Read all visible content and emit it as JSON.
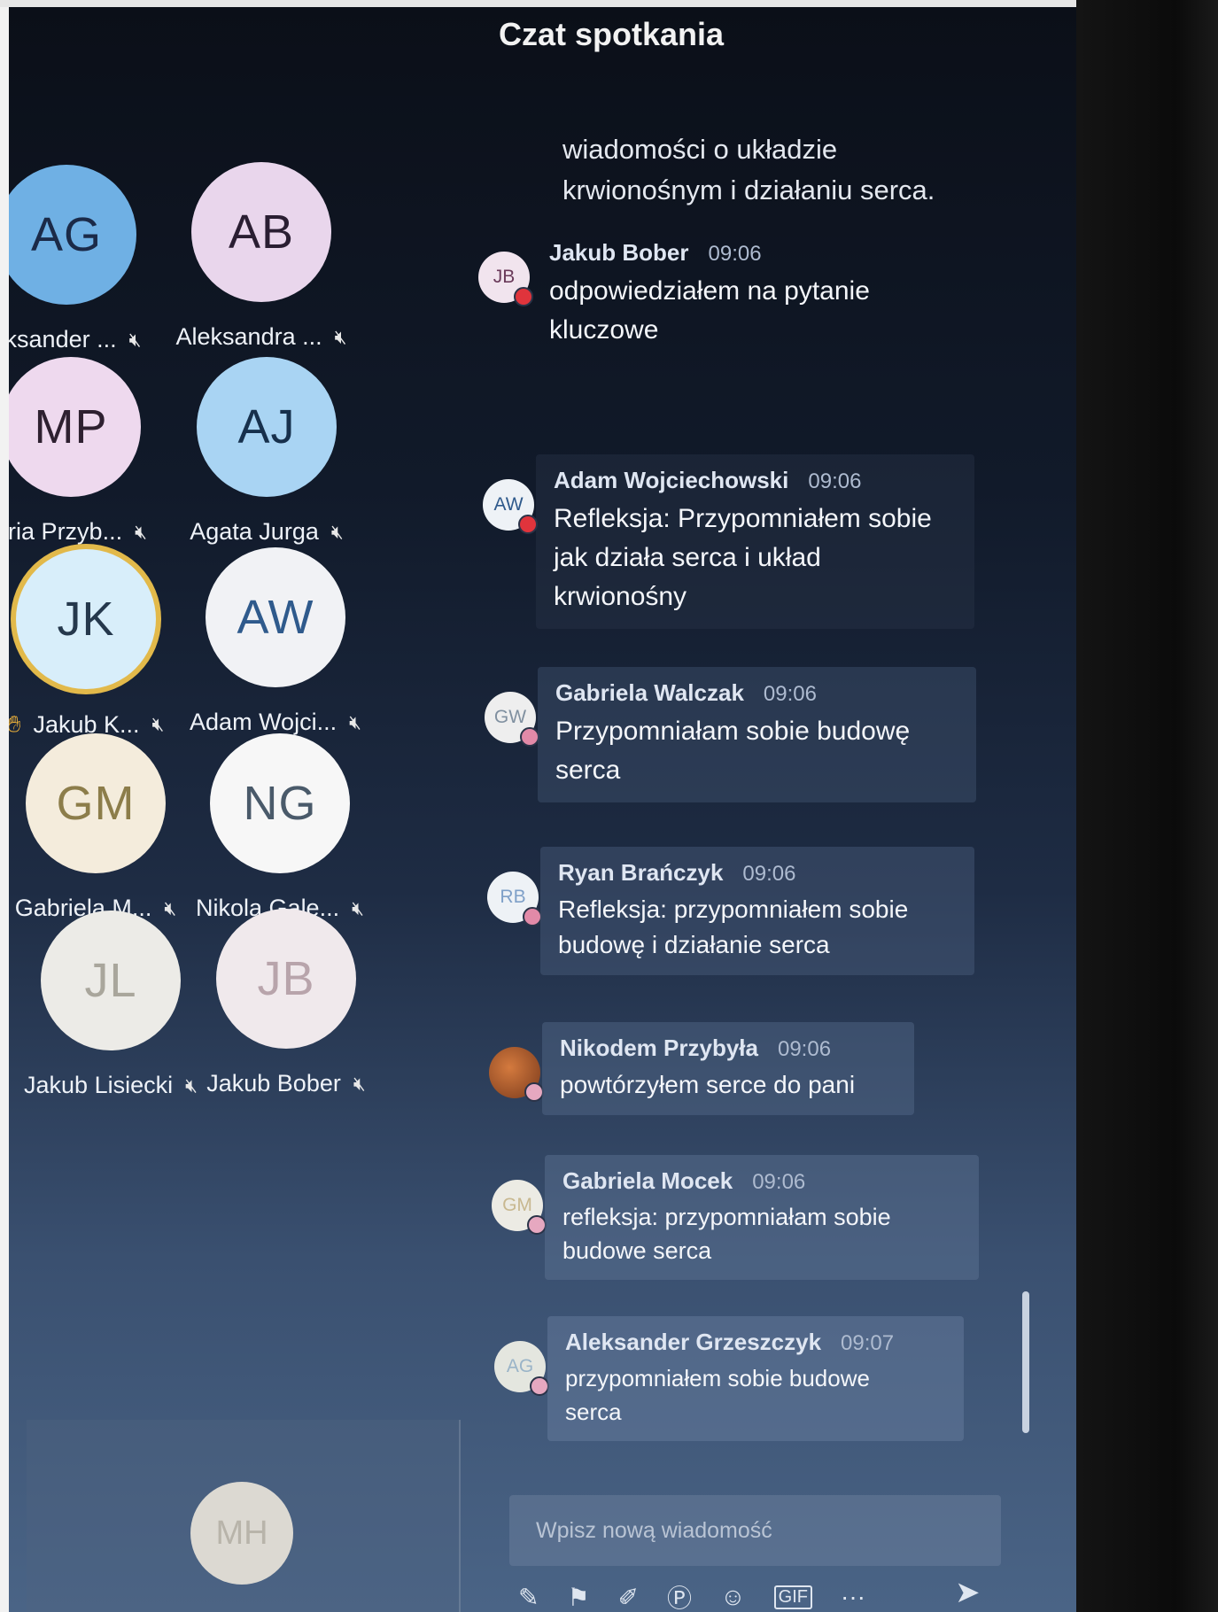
{
  "chat_title": "Czat spotkania",
  "intro_message": "wiadomości o układzie krwionośnym i działaniu serca.",
  "participants": [
    {
      "initials": "AG",
      "name": "eksander ...",
      "avatar_bg": "#6fb0e4",
      "avatar_fg": "#1b2a48",
      "raised_hand": false
    },
    {
      "initials": "AB",
      "name": "Aleksandra ...",
      "avatar_bg": "#e9d6ec",
      "avatar_fg": "#2a1e32",
      "raised_hand": false
    },
    {
      "initials": "MP",
      "name": "aria Przyb...",
      "avatar_bg": "#eed9ee",
      "avatar_fg": "#2e2030",
      "raised_hand": false
    },
    {
      "initials": "AJ",
      "name": "Agata Jurga",
      "avatar_bg": "#a9d4f3",
      "avatar_fg": "#17304c",
      "raised_hand": false
    },
    {
      "initials": "JK",
      "name": "Jakub K...",
      "avatar_bg": "#d8eefa",
      "avatar_fg": "#25384c",
      "raised_hand": true
    },
    {
      "initials": "AW",
      "name": "Adam Wojci...",
      "avatar_bg": "#f1f2f5",
      "avatar_fg": "#2f5a8c",
      "raised_hand": false
    },
    {
      "initials": "GM",
      "name": "Gabriela M...",
      "avatar_bg": "#f4ecdc",
      "avatar_fg": "#8c7d4a",
      "raised_hand": false
    },
    {
      "initials": "NG",
      "name": "Nikola Gale...",
      "avatar_bg": "#f7f7f7",
      "avatar_fg": "#4a5a6a",
      "raised_hand": false
    },
    {
      "initials": "JL",
      "name": "Jakub Lisiecki",
      "avatar_bg": "#ecebe7",
      "avatar_fg": "#a9a69c",
      "raised_hand": false
    },
    {
      "initials": "JB",
      "name": "Jakub Bober",
      "avatar_bg": "#f0e9ec",
      "avatar_fg": "#b8a4ab",
      "raised_hand": false
    }
  ],
  "bottom_participant": {
    "initials": "MH"
  },
  "messages": [
    {
      "initials": "JB",
      "author": "Jakub Bober",
      "time": "09:06",
      "text": "odpowiedziałem na pytanie kluczowe",
      "avatar_bg": "#f1e4ee",
      "avatar_fg": "#6a3a5a",
      "dot": "#e0343c"
    },
    {
      "initials": "AW",
      "author": "Adam Wojciechowski",
      "time": "09:06",
      "text": "Refleksja: Przypomniałem sobie jak działa serca i układ krwionośny",
      "avatar_bg": "#eef2f6",
      "avatar_fg": "#2f5a8c",
      "dot": "#e0343c"
    },
    {
      "initials": "GW",
      "author": "Gabriela Walczak",
      "time": "09:06",
      "text": "Przypomniałam sobie budowę serca",
      "avatar_bg": "#eeeeee",
      "avatar_fg": "#8090a0",
      "dot": "#e28aa8"
    },
    {
      "initials": "RB",
      "author": "Ryan Brańczyk",
      "time": "09:06",
      "text": "Refleksja: przypomniałem sobie budowę i działanie serca",
      "avatar_bg": "#eef2f6",
      "avatar_fg": "#7fa0c8",
      "dot": "#e28aa8"
    },
    {
      "initials": "",
      "author": "Nikodem Przybyła",
      "time": "09:06",
      "text": "powtórzyłem serce do pani",
      "avatar_bg": "#b86a3a",
      "avatar_fg": "#ffffff",
      "dot": "#e6a8c0"
    },
    {
      "initials": "GM",
      "author": "Gabriela Mocek",
      "time": "09:06",
      "text": "refleksja: przypomniałam sobie budowe serca",
      "avatar_bg": "#ecebe4",
      "avatar_fg": "#c8b890",
      "dot": "#e6a8c0"
    },
    {
      "initials": "AG",
      "author": "Aleksander Grzeszczyk",
      "time": "09:07",
      "text": "przypomniałem sobie budowe serca",
      "avatar_bg": "#e4e6df",
      "avatar_fg": "#9ab4c8",
      "dot": "#e6a8c0"
    }
  ],
  "compose": {
    "placeholder": "Wpisz nową wiadomość"
  },
  "toolbar_icons": [
    "format-icon",
    "attach-icon",
    "link-icon",
    "loop-icon",
    "emoji-icon",
    "gif-icon",
    "more-icon"
  ],
  "more_label": "···"
}
